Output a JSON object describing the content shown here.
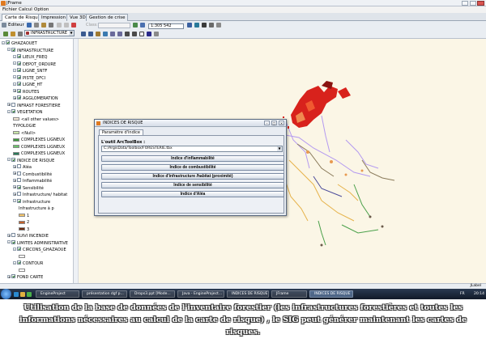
{
  "window": {
    "title": "JFrame"
  },
  "menu": [
    "Fichier",
    "Calcul",
    "Option"
  ],
  "tabs": [
    "Carte de Risque",
    "Impression",
    "Vue 3D",
    "Gestion de crise"
  ],
  "toolbar": {
    "editor_label": "Editeur",
    "layer_select_value": "INFRASTRUCTURE",
    "classe_label": "Class:",
    "scale_value": "1:305 542"
  },
  "tree": {
    "items": [
      {
        "label": "GHAZAOUET",
        "level": 0,
        "checked": true,
        "expander": "-"
      },
      {
        "label": "INFRASTRUCTURE",
        "level": 1,
        "checked": true,
        "expander": "-"
      },
      {
        "label": "LIEUX_FREQ",
        "level": 2,
        "checked": true,
        "expander": "-"
      },
      {
        "label": "DEPOT_ORDURE",
        "level": 2,
        "checked": true,
        "expander": "-"
      },
      {
        "label": "LIGNE_SNTF",
        "level": 2,
        "checked": true,
        "expander": "-"
      },
      {
        "label": "PISTE_DFCI",
        "level": 2,
        "checked": true,
        "expander": "-"
      },
      {
        "label": "LIGNE_HT",
        "level": 2,
        "checked": true,
        "expander": "-"
      },
      {
        "label": "ROUTES",
        "level": 2,
        "checked": true,
        "expander": "+"
      },
      {
        "label": "AGGLOMERATION",
        "level": 2,
        "checked": true,
        "expander": "+"
      },
      {
        "label": "INFRAST FORESTIERE",
        "level": 1,
        "checked": false,
        "expander": "+"
      },
      {
        "label": "VEGETATION",
        "level": 1,
        "checked": true,
        "expander": "-"
      },
      {
        "label": "<all other values>",
        "level": 2,
        "swatch": "#f4e7d6"
      },
      {
        "label": "TYPOLOGIE",
        "level": 2
      },
      {
        "label": "<Null>",
        "level": 2,
        "swatch": "#c9e6a8"
      },
      {
        "label": "COMPLEXES LIGNEUX",
        "level": 2,
        "swatch": "#3c9a3c"
      },
      {
        "label": "COMPLEXES LIGNEUX",
        "level": 2,
        "swatch": "#6cc46c"
      },
      {
        "label": "COMPLEXES LIGNEUX",
        "level": 2,
        "swatch": "#2a7a5a"
      },
      {
        "label": "INDICE DE RISQUE",
        "level": 1,
        "checked": true,
        "expander": "-"
      },
      {
        "label": "Aléa",
        "level": 2,
        "checked": false,
        "expander": "+"
      },
      {
        "label": "Combustibilité",
        "level": 2,
        "checked": false,
        "expander": "+"
      },
      {
        "label": "Inflammabilité",
        "level": 2,
        "checked": false,
        "expander": "+"
      },
      {
        "label": "Sensibilité",
        "level": 2,
        "checked": true,
        "expander": "+"
      },
      {
        "label": "Infrastructure/ habitat",
        "level": 2,
        "checked": false,
        "expander": "+"
      },
      {
        "label": "infrastructure",
        "level": 2,
        "checked": true,
        "expander": "-"
      },
      {
        "label": "Infrastructure à p",
        "level": 3
      },
      {
        "label": "1",
        "level": 3,
        "swatch": "#f2c46a"
      },
      {
        "label": "2",
        "level": 3,
        "swatch": "#c0602a"
      },
      {
        "label": "3",
        "level": 3,
        "swatch": "#6a2a10"
      },
      {
        "label": "SUIVI INCENDIE",
        "level": 1,
        "checked": false,
        "expander": "+"
      },
      {
        "label": "LIMITES ADMINISTRATIVE",
        "level": 1,
        "checked": true,
        "expander": "-"
      },
      {
        "label": "CIRCONS_GHAZAOUE",
        "level": 2,
        "checked": true,
        "expander": "-"
      },
      {
        "label": "",
        "level": 3,
        "swatch": "#ffffff"
      },
      {
        "label": "CONTOUR",
        "level": 2,
        "checked": true,
        "expander": "-"
      },
      {
        "label": "",
        "level": 3,
        "swatch": "#ffffff"
      },
      {
        "label": "FOND CARTE",
        "level": 1,
        "checked": true,
        "expander": "+"
      }
    ]
  },
  "dialog": {
    "title": "INDICES DE RISQUE",
    "tab": "Paramètre d'indice",
    "toolbox_label": "L'outil ArcToolBox :",
    "toolbox_path": "C:/ArgisData/Toolbox/FORESTERIE.tbx",
    "buttons": [
      "Indice d'inflammabilité",
      "Indice de combustibilité",
      "Indice d'infrastructure /habitat (proximité)",
      "Indice de sensibilité",
      "Indice d'Aléa"
    ]
  },
  "statusbar": {
    "right_text": "JLabel"
  },
  "taskbar": {
    "items": [
      "EngineProject",
      "présentation dgf p...",
      "Drops3.ppt [Mode...",
      "Java - EngineProject...",
      "INDICES DE RISQUE",
      "JFrame",
      "INDICES DE RISQUE"
    ],
    "lang": "FR",
    "time": "20:14"
  },
  "caption": "Utilisation de la base de données de l'inventaire forestier (les infrastructures forestières et toutes les informations nécessaires au calcul de la carte de risque) , le SIG peut générer maintenant les cartes de risques."
}
